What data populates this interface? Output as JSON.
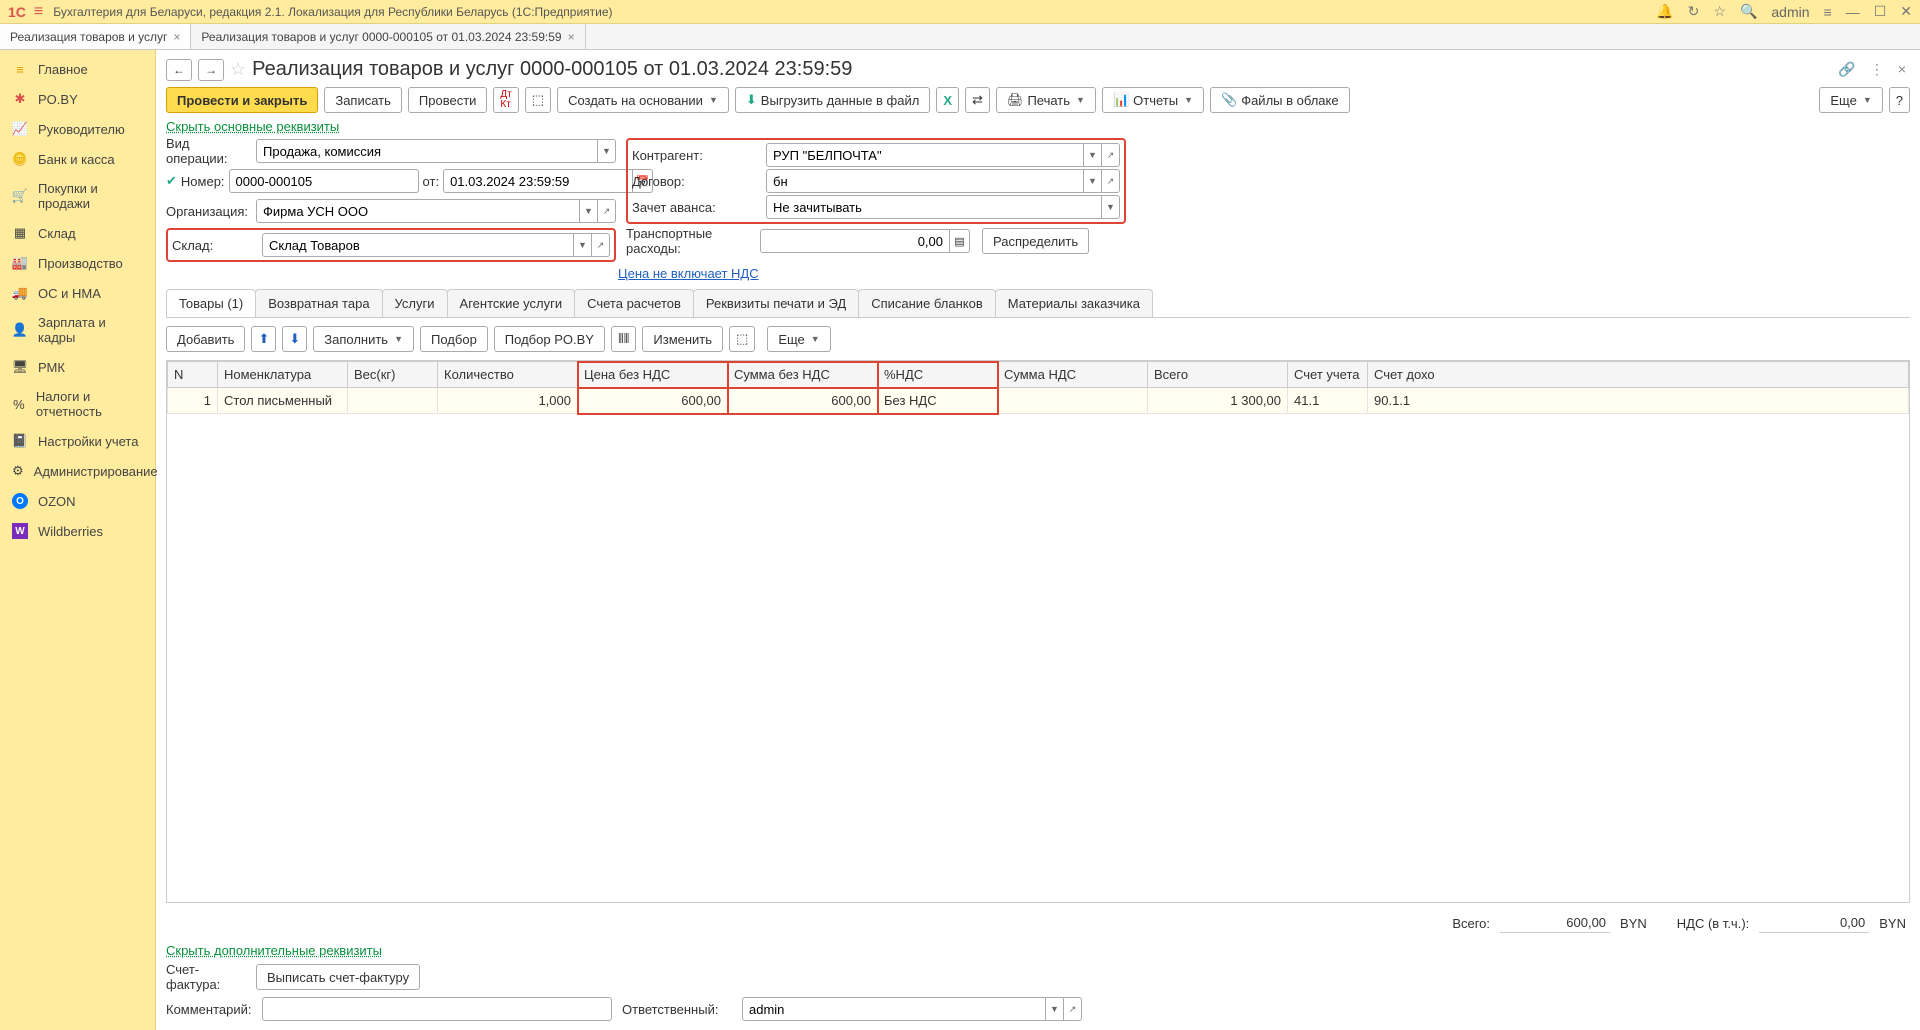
{
  "titlebar": {
    "app_title": "Бухгалтерия для Беларуси, редакция 2.1. Локализация для Республики Беларусь   (1С:Предприятие)",
    "user": "admin",
    "logo": "1C"
  },
  "tabs": [
    {
      "label": "Реализация товаров и услуг",
      "active": false
    },
    {
      "label": "Реализация товаров и услуг 0000-000105 от 01.03.2024 23:59:59",
      "active": true
    }
  ],
  "sidebar": {
    "items": [
      {
        "label": "Главное",
        "icon": "≡",
        "color": "#d4a000"
      },
      {
        "label": "PO.BY",
        "icon": "✱",
        "color": "#d9534f"
      },
      {
        "label": "Руководителю",
        "icon": "📈",
        "color": "#888"
      },
      {
        "label": "Банк и касса",
        "icon": "🪙",
        "color": "#888"
      },
      {
        "label": "Покупки и продажи",
        "icon": "🛒",
        "color": "#888"
      },
      {
        "label": "Склад",
        "icon": "▦",
        "color": "#888"
      },
      {
        "label": "Производство",
        "icon": "🏭",
        "color": "#888"
      },
      {
        "label": "ОС и НМА",
        "icon": "🚚",
        "color": "#888"
      },
      {
        "label": "Зарплата и кадры",
        "icon": "👤",
        "color": "#888"
      },
      {
        "label": "РМК",
        "icon": "🖥",
        "color": "#888"
      },
      {
        "label": "Налоги и отчетность",
        "icon": "%",
        "color": "#888"
      },
      {
        "label": "Настройки учета",
        "icon": "📓",
        "color": "#888"
      },
      {
        "label": "Администрирование",
        "icon": "⚙",
        "color": "#888"
      },
      {
        "label": "OZON",
        "icon": "O",
        "color": "#0077ff"
      },
      {
        "label": "Wildberries",
        "icon": "W",
        "color": "#7b2cbf"
      }
    ]
  },
  "doc": {
    "title": "Реализация товаров и услуг 0000-000105 от 01.03.2024 23:59:59"
  },
  "toolbar": {
    "post_close": "Провести и закрыть",
    "write": "Записать",
    "post": "Провести",
    "create_based": "Создать на основании",
    "export_file": "Выгрузить данные в файл",
    "print": "Печать",
    "reports": "Отчеты",
    "cloud_files": "Файлы в облаке",
    "more": "Еще"
  },
  "links": {
    "hide_main": "Скрыть основные реквизиты",
    "vat_mode": "Цена не включает НДС",
    "hide_extra": "Скрыть дополнительные реквизиты"
  },
  "form": {
    "left": {
      "op_type": {
        "label": "Вид операции:",
        "value": "Продажа, комиссия"
      },
      "number": {
        "label": "Номер:",
        "value": "0000-000105",
        "from_label": "от:"
      },
      "date": {
        "value": "01.03.2024 23:59:59"
      },
      "org": {
        "label": "Организация:",
        "value": "Фирма УСН ООО"
      },
      "warehouse": {
        "label": "Склад:",
        "value": "Склад Товаров"
      }
    },
    "right": {
      "counterparty": {
        "label": "Контрагент:",
        "value": "РУП \"БЕЛПОЧТА\""
      },
      "contract": {
        "label": "Договор:",
        "value": "бн"
      },
      "advance": {
        "label": "Зачет аванса:",
        "value": "Не зачитывать"
      },
      "transport": {
        "label": "Транспортные расходы:",
        "value": "0,00",
        "distribute": "Распределить"
      }
    }
  },
  "subtabs": [
    "Товары (1)",
    "Возвратная тара",
    "Услуги",
    "Агентские услуги",
    "Счета расчетов",
    "Реквизиты печати и ЭД",
    "Списание бланков",
    "Материалы заказчика"
  ],
  "subtoolbar": {
    "add": "Добавить",
    "fill": "Заполнить",
    "pick": "Подбор",
    "pick_poby": "Подбор PO.BY",
    "edit": "Изменить",
    "more": "Еще"
  },
  "table": {
    "headers": [
      "N",
      "Номенклатура",
      "Вес(кг)",
      "Количество",
      "Цена без НДС",
      "Сумма без НДС",
      "%НДС",
      "Сумма НДС",
      "Всего",
      "Счет учета",
      "Счет дохо"
    ],
    "rows": [
      {
        "n": "1",
        "item": "Стол письменный",
        "weight": "",
        "qty": "1,000",
        "price": "600,00",
        "sum": "600,00",
        "vat_pct": "Без НДС",
        "vat_sum": "",
        "total": "1 300,00",
        "acct": "41.1",
        "acct2": "90.1.1"
      }
    ]
  },
  "totals": {
    "label_total": "Всего:",
    "total": "600,00",
    "cur1": "BYN",
    "label_vat": "НДС (в т.ч.):",
    "vat": "0,00",
    "cur2": "BYN"
  },
  "bottom": {
    "invoice": {
      "label": "Счет-фактура:",
      "button": "Выписать счет-фактуру"
    },
    "comment": {
      "label": "Комментарий:",
      "value": ""
    },
    "responsible": {
      "label": "Ответственный:",
      "value": "admin"
    }
  }
}
